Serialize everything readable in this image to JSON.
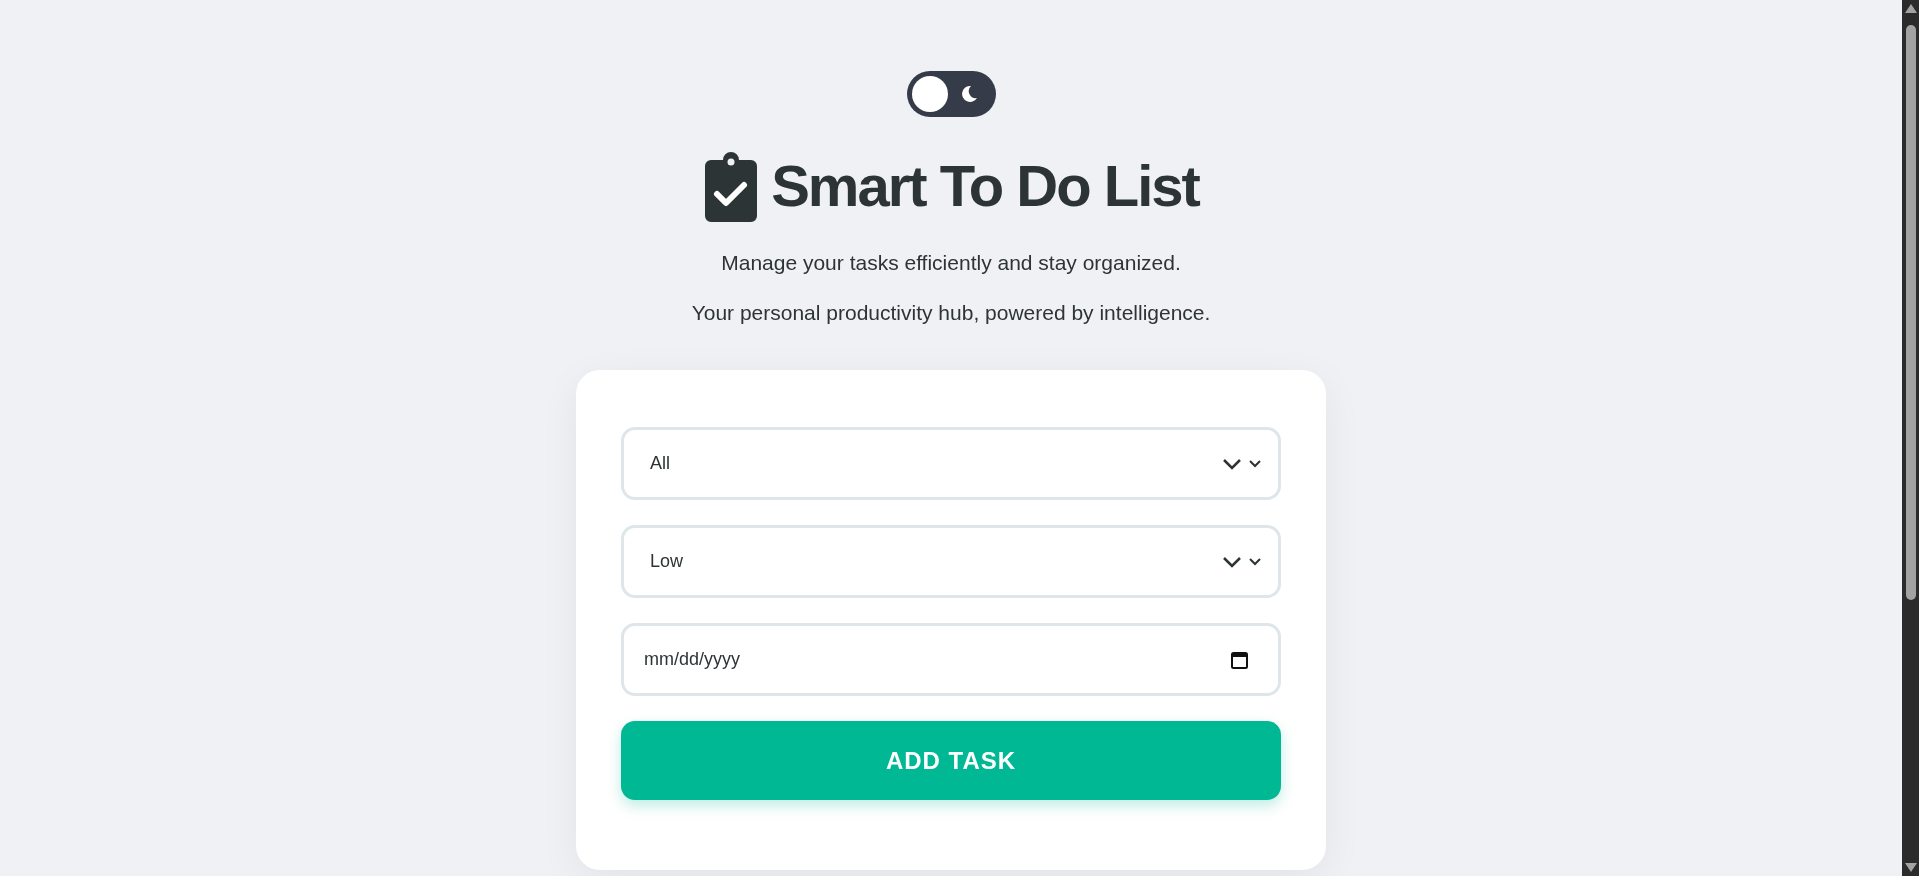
{
  "theme_toggle": {
    "on": false
  },
  "header": {
    "title": "Smart To Do List",
    "subtitles": [
      "Manage your tasks efficiently and stay organized.",
      "Your personal productivity hub, powered by intelligence."
    ]
  },
  "form": {
    "fields": [
      {
        "kind": "select",
        "value": "All"
      },
      {
        "kind": "select",
        "value": "Low"
      },
      {
        "kind": "date",
        "placeholder": "mm/dd/yyyy"
      }
    ],
    "submit": "ADD TASK"
  }
}
